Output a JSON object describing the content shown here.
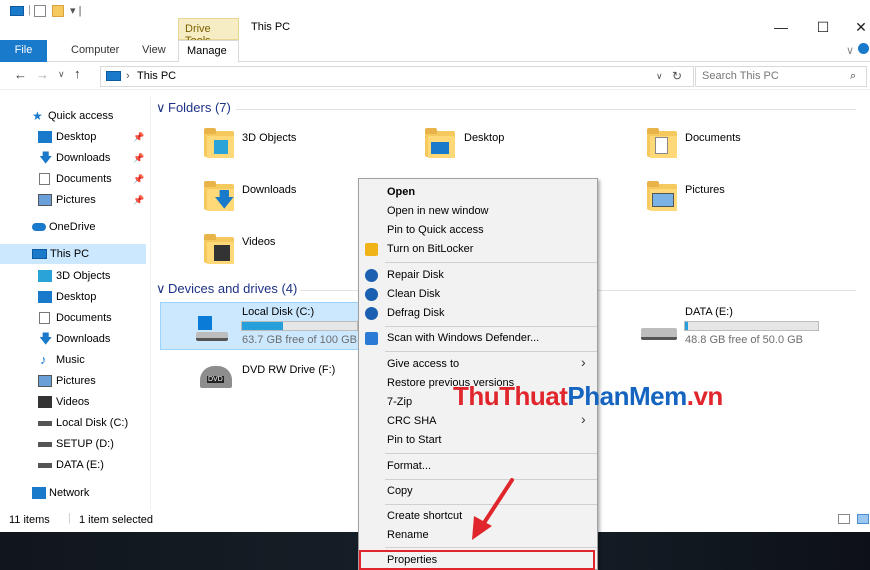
{
  "window": {
    "title": "This PC",
    "contextual_tab": "Drive Tools",
    "controls": {
      "minimize": "—",
      "maximize": "☐",
      "close": "✕"
    }
  },
  "ribbon": {
    "tabs": [
      "File",
      "Computer",
      "View",
      "Manage"
    ],
    "expand": "∨"
  },
  "address": {
    "path": "This PC",
    "search_placeholder": "Search This PC"
  },
  "sidebar": {
    "items": [
      {
        "label": "Quick access",
        "icon": "star-icon"
      },
      {
        "label": "Desktop",
        "icon": "desktop-icon"
      },
      {
        "label": "Downloads",
        "icon": "download-icon"
      },
      {
        "label": "Documents",
        "icon": "documents-icon"
      },
      {
        "label": "Pictures",
        "icon": "pictures-icon"
      },
      {
        "label": "OneDrive",
        "icon": "cloud-icon"
      },
      {
        "label": "This PC",
        "icon": "computer-icon"
      },
      {
        "label": "3D Objects",
        "icon": "cube-icon"
      },
      {
        "label": "Desktop",
        "icon": "desktop-icon"
      },
      {
        "label": "Documents",
        "icon": "documents-icon"
      },
      {
        "label": "Downloads",
        "icon": "download-icon"
      },
      {
        "label": "Music",
        "icon": "music-icon"
      },
      {
        "label": "Pictures",
        "icon": "pictures-icon"
      },
      {
        "label": "Videos",
        "icon": "videos-icon"
      },
      {
        "label": "Local Disk (C:)",
        "icon": "drive-icon"
      },
      {
        "label": "SETUP (D:)",
        "icon": "drive-icon"
      },
      {
        "label": "DATA (E:)",
        "icon": "drive-icon"
      },
      {
        "label": "Network",
        "icon": "network-icon"
      }
    ]
  },
  "folders": {
    "header": "Folders (7)",
    "items": [
      "3D Objects",
      "Desktop",
      "Documents",
      "Downloads",
      "Pictures",
      "Videos"
    ]
  },
  "drives": {
    "header": "Devices and drives (4)",
    "items": [
      {
        "name": "Local Disk (C:)",
        "free": "63.7 GB free of 100 GB",
        "used_fraction": 0.36
      },
      {
        "name": "DATA (E:)",
        "free": "48.8 GB free of 50.0 GB",
        "used_fraction": 0.024
      },
      {
        "name": "DVD RW Drive (F:)",
        "badge": "DVD"
      }
    ]
  },
  "status": {
    "items": "11 items",
    "selected": "1 item selected"
  },
  "context_menu": {
    "items": [
      "Open",
      "Open in new window",
      "Pin to Quick access",
      "Turn on BitLocker",
      "Repair Disk",
      "Clean Disk",
      "Defrag Disk",
      "Scan with Windows Defender...",
      "Give access to",
      "Restore previous versions",
      "7-Zip",
      "CRC SHA",
      "Pin to Start",
      "Format...",
      "Copy",
      "Create shortcut",
      "Rename",
      "Properties"
    ]
  },
  "watermark": {
    "part1": "ThuThuat",
    "part2": "PhanMem",
    "part3": ".vn"
  },
  "colors": {
    "accent": "#1979ca",
    "selection": "#cce8ff",
    "highlight_box": "#e0262c",
    "arrow": "#e0262c"
  }
}
